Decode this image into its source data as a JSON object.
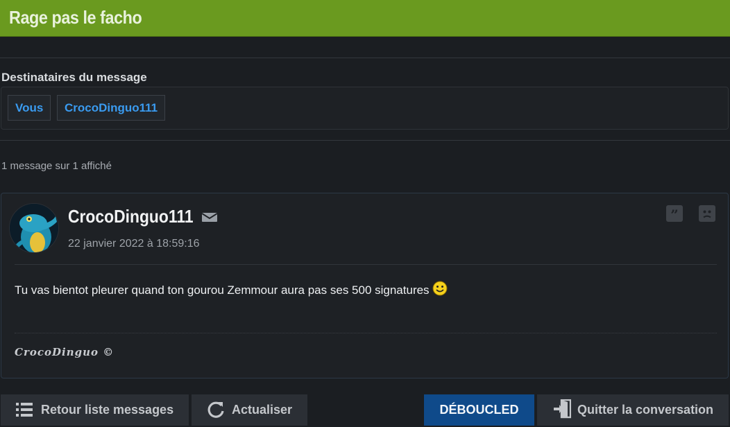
{
  "header": {
    "title": "Rage pas le facho"
  },
  "recipients": {
    "label": "Destinataires du message",
    "items": [
      "Vous",
      "CrocoDinguo111"
    ]
  },
  "message_count": "1 message sur 1 affiché",
  "message": {
    "author": "CrocoDinguo111",
    "date": "22 janvier 2022 à 18:59:16",
    "body": "Tu vas bientot pleurer quand ton gourou Zemmour aura pas ses 500 signatures",
    "signature": "CrocoDinguo ©"
  },
  "actions": {
    "back": "Retour liste messages",
    "refresh": "Actualiser",
    "unblock": "DÉBOUCLED",
    "leave": "Quitter la conversation"
  },
  "colors": {
    "header_bg": "#6a9a1f",
    "link": "#3a9bf0",
    "primary_button": "#0f4a8a"
  },
  "icons": [
    "mail-icon",
    "quote-icon",
    "report-icon",
    "list-icon",
    "refresh-icon",
    "exit-icon",
    "smiley-icon"
  ]
}
